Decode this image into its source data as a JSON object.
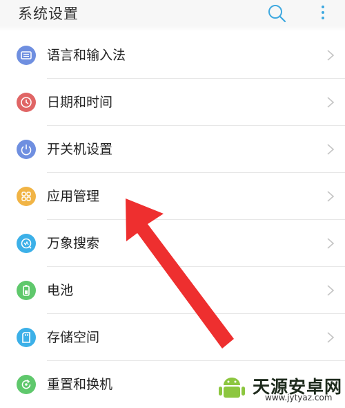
{
  "header": {
    "title": "系统设置",
    "search_icon": "search-icon",
    "more_icon": "more-vertical-icon"
  },
  "settings": [
    {
      "label": "语言和输入法",
      "icon": "keyboard-icon",
      "color": "#6f8fe0"
    },
    {
      "label": "日期和时间",
      "icon": "clock-icon",
      "color": "#e06565"
    },
    {
      "label": "开关机设置",
      "icon": "power-icon",
      "color": "#6f8fe0"
    },
    {
      "label": "应用管理",
      "icon": "apps-grid-icon",
      "color": "#f1b445"
    },
    {
      "label": "万象搜索",
      "icon": "search-q-icon",
      "color": "#3cb0e8"
    },
    {
      "label": "电池",
      "icon": "battery-icon",
      "color": "#5fc86c"
    },
    {
      "label": "存储空间",
      "icon": "sd-card-icon",
      "color": "#3cb0e8"
    },
    {
      "label": "重置和换机",
      "icon": "reset-icon",
      "color": "#5fc86c"
    }
  ],
  "watermark": {
    "name": "天源安卓网",
    "url": "www.jytyaz.com"
  },
  "colors": {
    "accent": "#3fa9e0",
    "arrow": "#ee2f2f",
    "separator": "#e7e7e7"
  }
}
